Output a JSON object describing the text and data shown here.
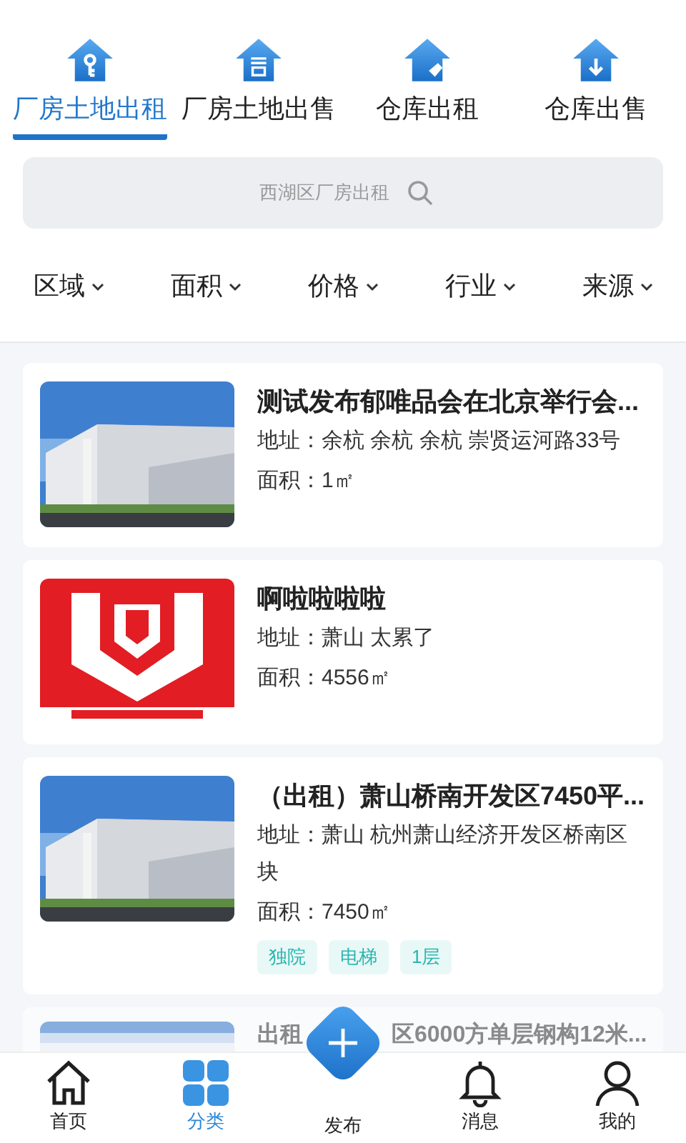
{
  "categories": [
    {
      "label": "厂房土地出租",
      "kind": "key",
      "selected": true
    },
    {
      "label": "厂房土地出售",
      "kind": "sale",
      "selected": false
    },
    {
      "label": "仓库出租",
      "kind": "tag",
      "selected": false
    },
    {
      "label": "仓库出售",
      "kind": "down",
      "selected": false
    }
  ],
  "search": {
    "placeholder": "西湖区厂房出租"
  },
  "filters": [
    "区域",
    "面积",
    "价格",
    "行业",
    "来源"
  ],
  "listings": [
    {
      "title": "测试发布郁唯品会在北京举行会...",
      "address": "地址：余杭 余杭 余杭 崇贤运河路33号",
      "area": "面积：1㎡"
    },
    {
      "title": "啊啦啦啦啦",
      "address": "地址：萧山 太累了",
      "area": "面积：4556㎡"
    },
    {
      "title": "（出租）萧山桥南开发区7450平...",
      "address": "地址：萧山 杭州萧山经济开发区桥南区块",
      "area": "面积：7450㎡",
      "tags": [
        "独院",
        "电梯",
        "1层"
      ]
    }
  ],
  "partial_listing": {
    "title_parts": [
      "出租",
      "区6000方单层钢构12米..."
    ]
  },
  "nav": [
    {
      "label": "首页",
      "kind": "home",
      "selected": false
    },
    {
      "label": "分类",
      "kind": "grid",
      "selected": true
    },
    {
      "label": "发布",
      "kind": "publish",
      "selected": false
    },
    {
      "label": "消息",
      "kind": "bell",
      "selected": false
    },
    {
      "label": "我的",
      "kind": "user",
      "selected": false
    }
  ]
}
